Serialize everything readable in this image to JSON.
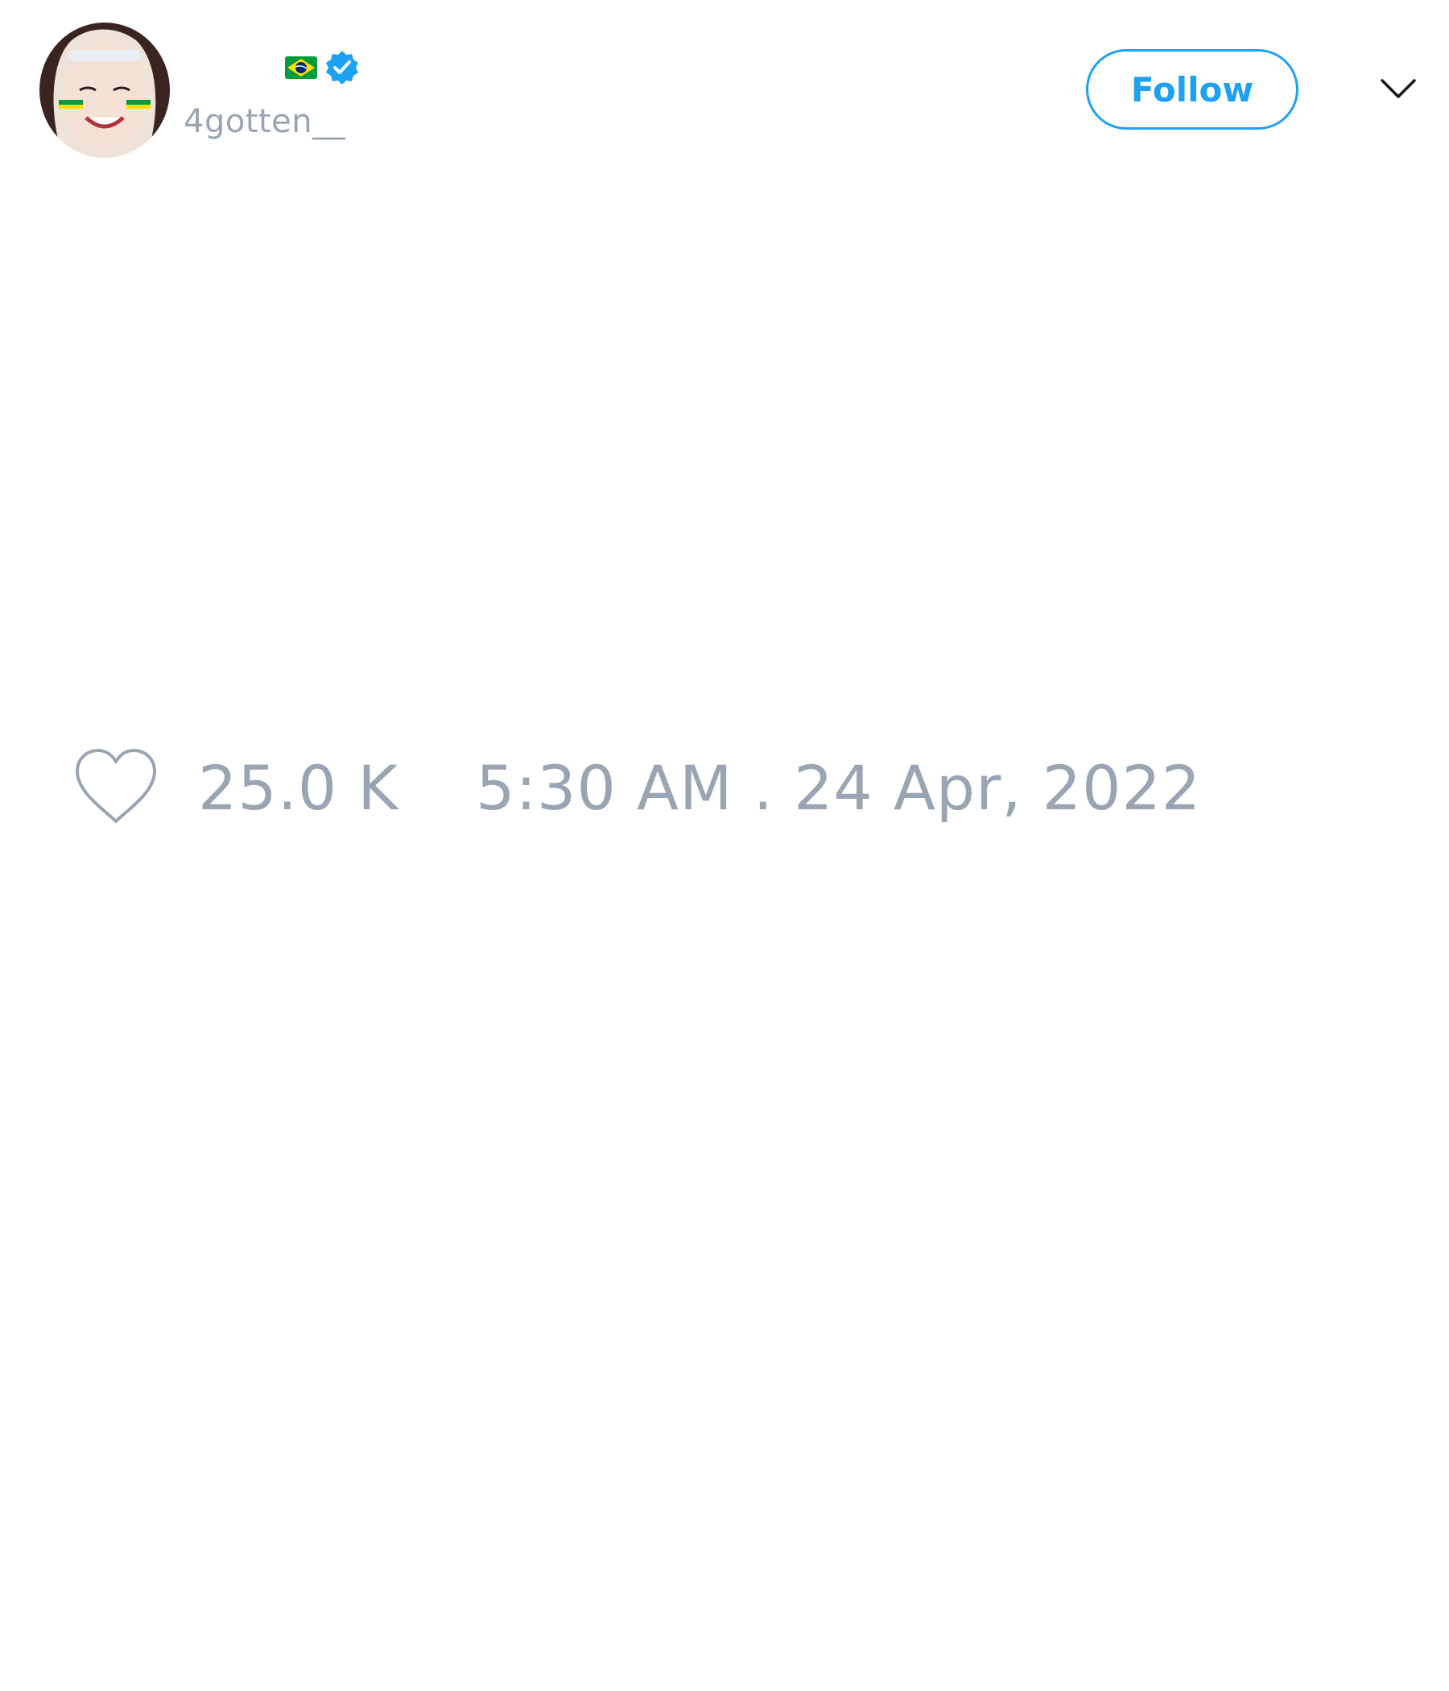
{
  "tweet": {
    "author": {
      "display_name": "",
      "flag": "brazil-flag",
      "verified": true,
      "handle": "4gotten__"
    },
    "follow_label": "Follow",
    "menu_icon": "chevron-down-icon",
    "like_icon": "heart-icon",
    "like_count": "25.0 K",
    "timestamp": "5:30 AM . 24 Apr, 2022"
  },
  "colors": {
    "accent": "#1da1f2",
    "muted": "#9aa5b4",
    "background": "#ffffff"
  }
}
